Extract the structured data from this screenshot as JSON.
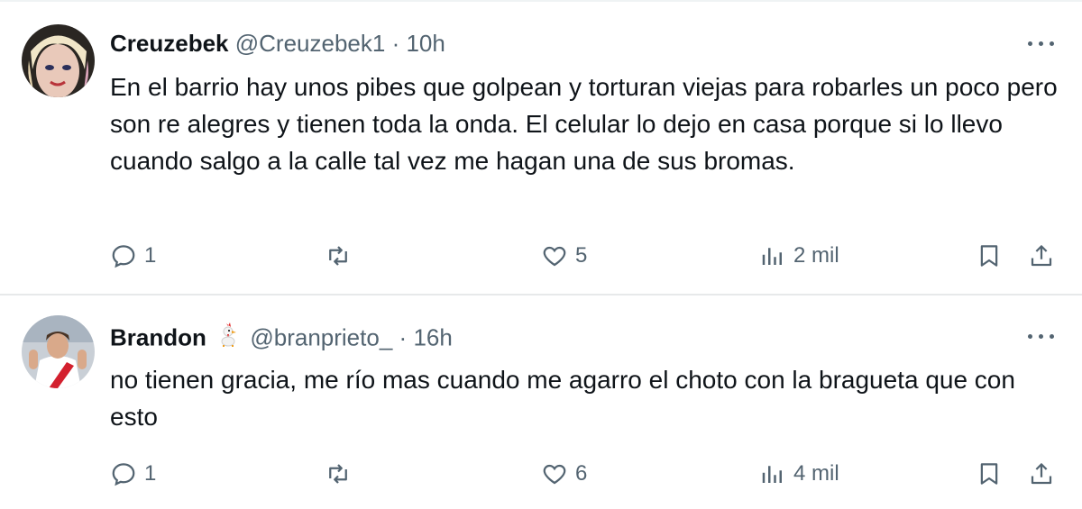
{
  "tweets": [
    {
      "name": "Creuzebek",
      "handle": "@Creuzebek1",
      "separator": "·",
      "time": "10h",
      "text": "En el barrio hay unos pibes que golpean y torturan viejas para robarles un poco pero son re alegres y tienen toda la onda. El celular lo dejo en casa porque si lo llevo cuando salgo a la calle tal vez me hagan una de sus bromas.",
      "replies": "1",
      "retweets": "",
      "likes": "5",
      "views": "2 mil"
    },
    {
      "name": "Brandon",
      "badge_icon": "rooster-emoji-icon",
      "handle": "@branprieto_",
      "separator": "·",
      "time": "16h",
      "text": "no tienen gracia, me río mas cuando me agarro el choto con la bragueta que con esto",
      "replies": "1",
      "retweets": "",
      "likes": "6",
      "views": "4 mil"
    }
  ],
  "colors": {
    "text": "#0f1419",
    "secondary": "#536471",
    "divider": "#e7e9ea",
    "background": "#ffffff"
  }
}
